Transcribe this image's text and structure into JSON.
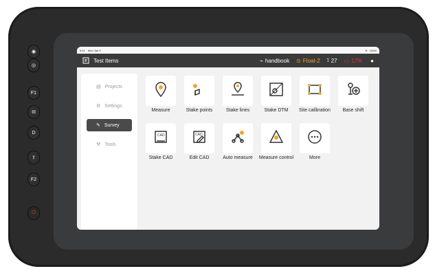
{
  "app": {
    "status": {
      "time": "9:41",
      "date": "Mon Jan 9",
      "battery": "100%"
    },
    "topbar": {
      "title": "Test Items",
      "handbook_label": "handbook",
      "float_label": "Float-2",
      "satellites_label": "27",
      "battery_label": "17%"
    },
    "sidebar": [
      {
        "label": "Projects",
        "active": false
      },
      {
        "label": "Settings",
        "active": false
      },
      {
        "label": "Survey",
        "active": true
      },
      {
        "label": "Tools",
        "active": false
      }
    ],
    "tiles": [
      {
        "label": "Measure"
      },
      {
        "label": "Stake points"
      },
      {
        "label": "Stake lines"
      },
      {
        "label": "Stake DTM"
      },
      {
        "label": "Site calibration"
      },
      {
        "label": "Base shift"
      },
      {
        "label": "Stake CAD"
      },
      {
        "label": "Edit CAD"
      },
      {
        "label": "Auto measure"
      },
      {
        "label": "Measure control"
      },
      {
        "label": "More"
      }
    ],
    "hardware_buttons": [
      {
        "label": "F1"
      },
      {
        "label": "III"
      },
      {
        "label": "D"
      },
      {
        "label": "F2"
      }
    ],
    "colors": {
      "accent_orange": "#f3a52b",
      "battery_red": "#e23b3b"
    }
  }
}
